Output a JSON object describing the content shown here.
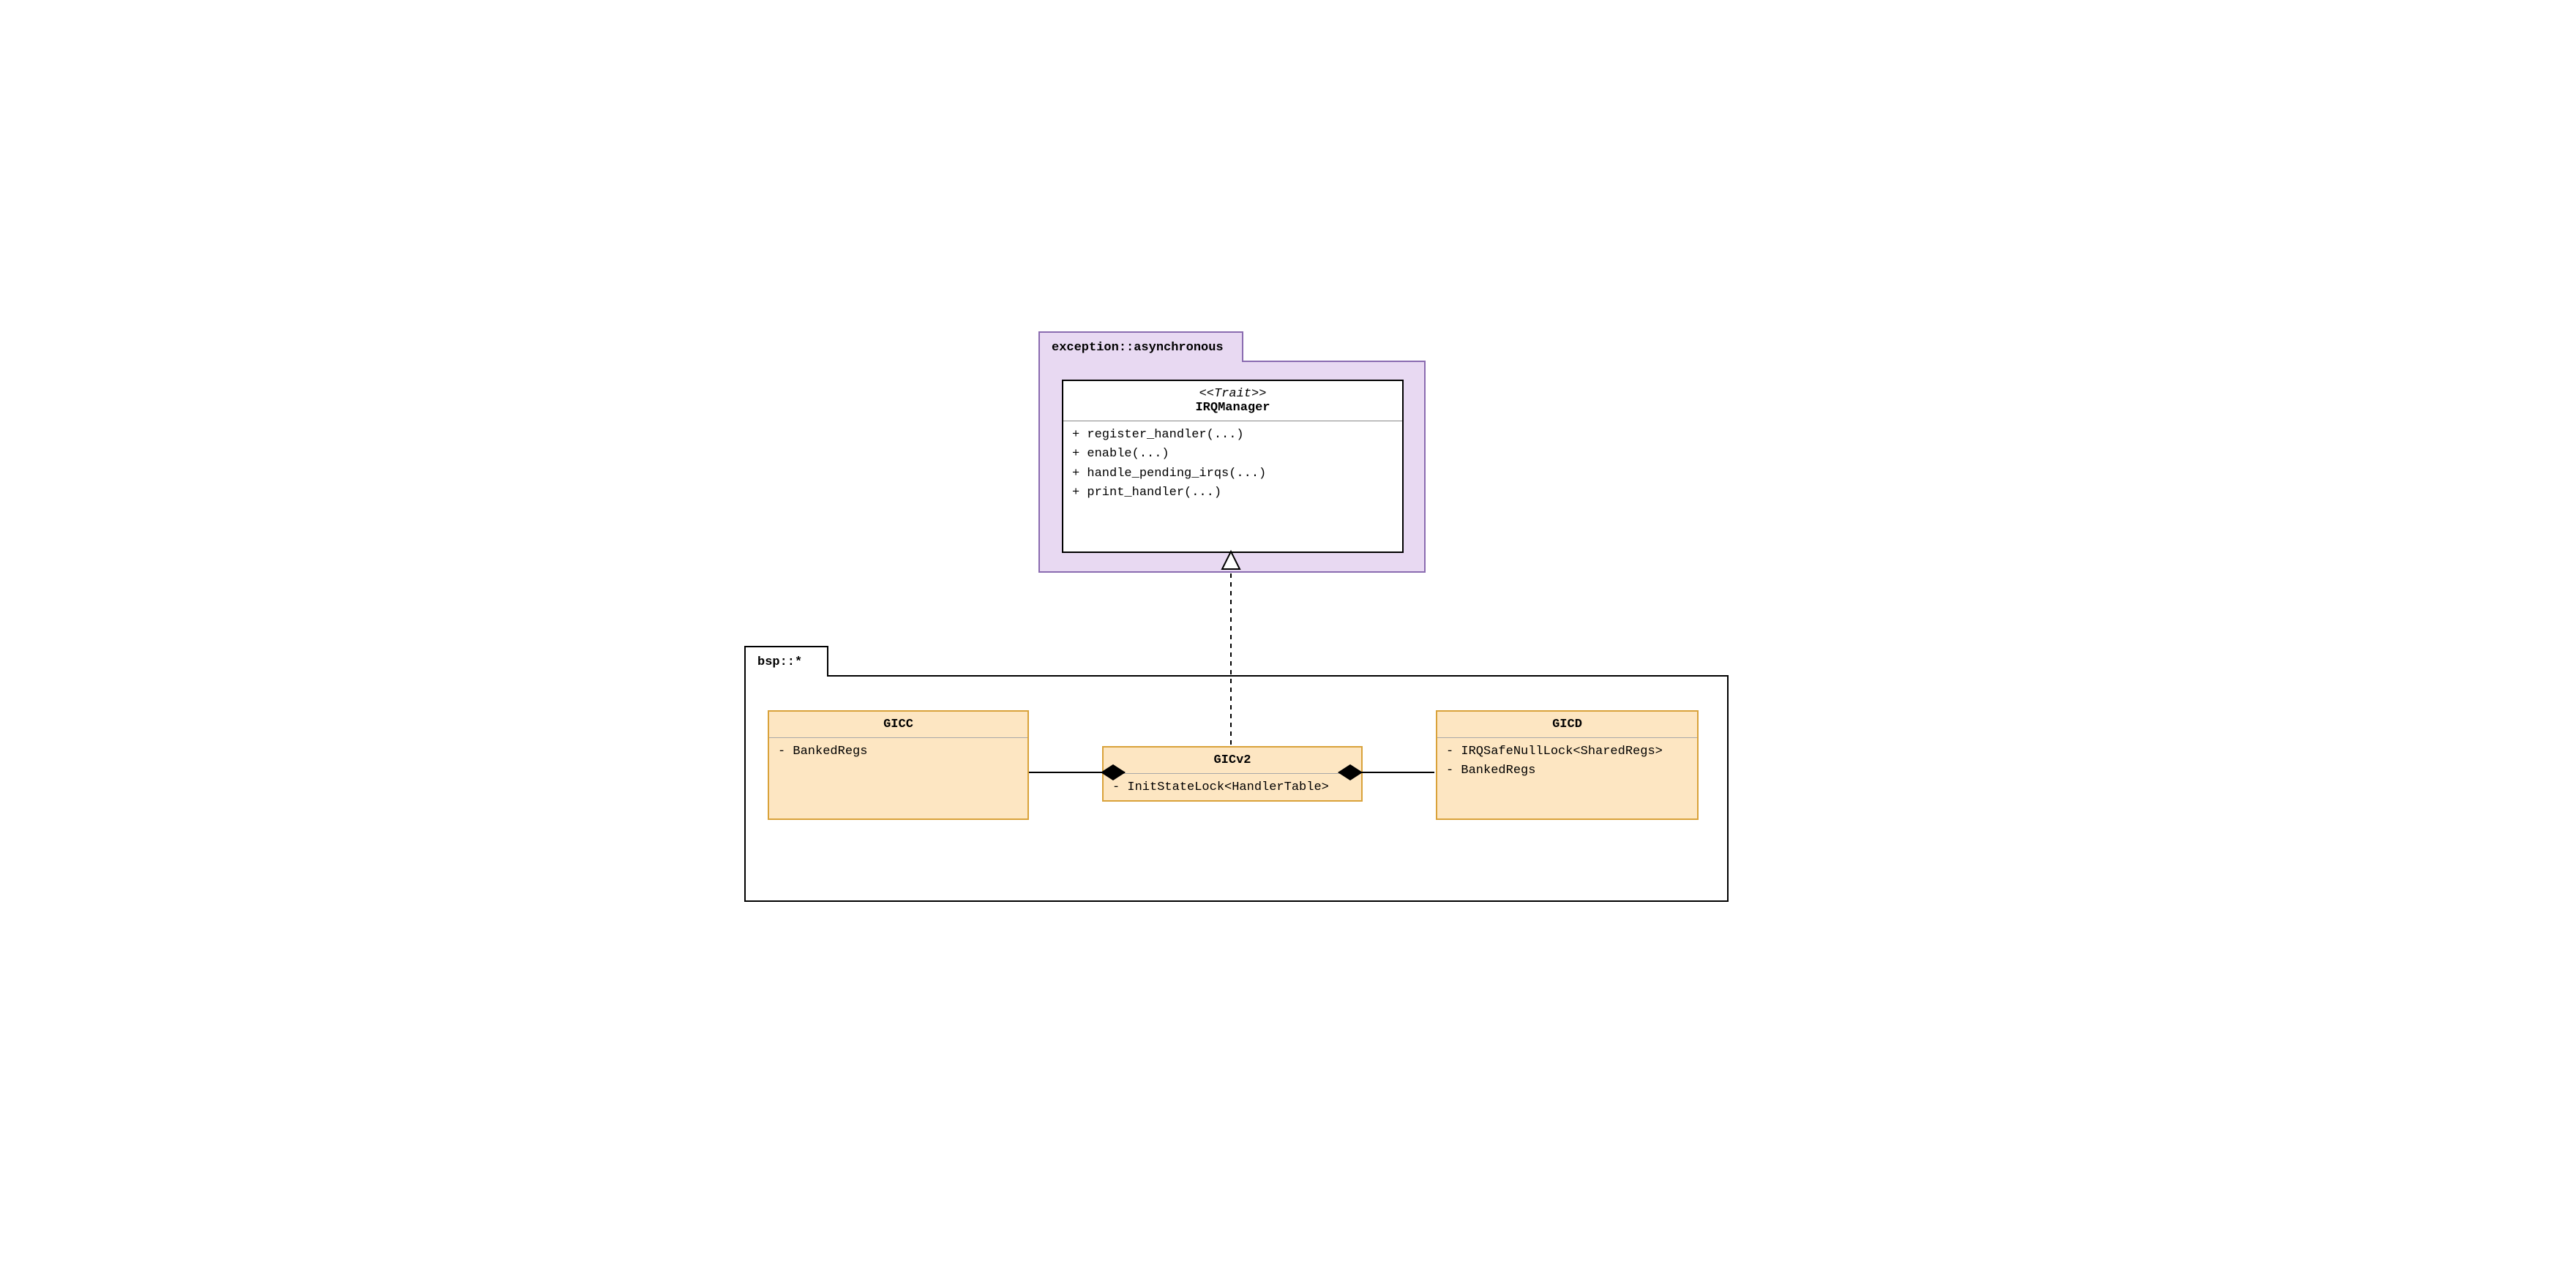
{
  "packages": {
    "exception_async": {
      "label": "exception::asynchronous"
    },
    "bsp": {
      "label": "bsp::*"
    }
  },
  "classes": {
    "irq_manager": {
      "stereotype": "<<Trait>>",
      "name": "IRQManager",
      "methods": [
        "+ register_handler(...)",
        "+ enable(...)",
        "+ handle_pending_irqs(...)",
        "+ print_handler(...)"
      ]
    },
    "gicc": {
      "name": "GICC",
      "attrs": [
        "- BankedRegs"
      ]
    },
    "gicv2": {
      "name": "GICv2",
      "attrs": [
        "- InitStateLock<HandlerTable>"
      ]
    },
    "gicd": {
      "name": "GICD",
      "attrs": [
        "- IRQSafeNullLock<SharedRegs>",
        "- BankedRegs"
      ]
    }
  }
}
